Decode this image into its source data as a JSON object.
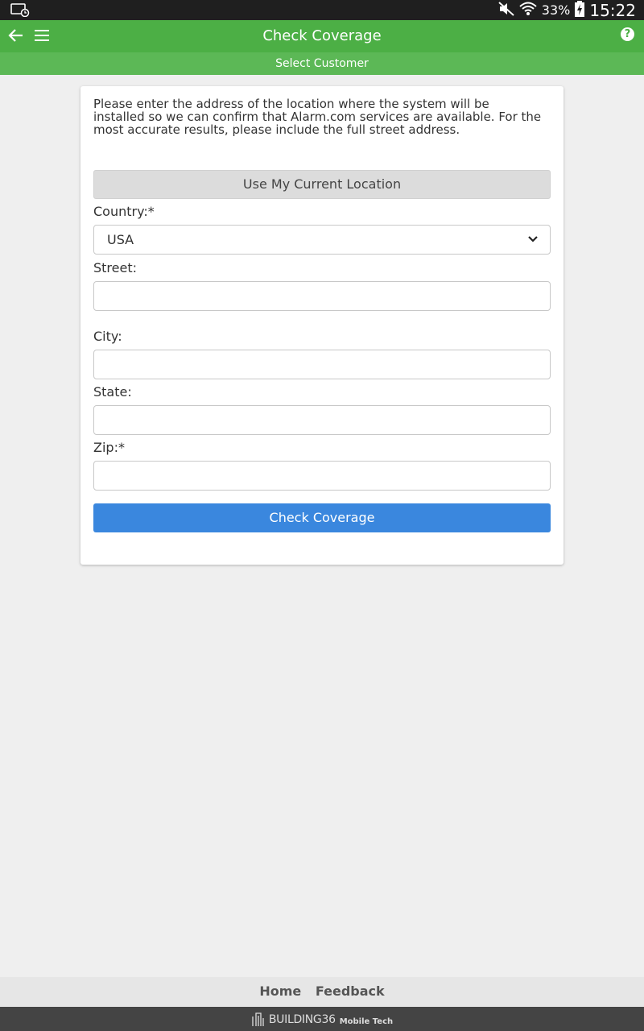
{
  "status_bar": {
    "battery_percent": "33%",
    "time": "15:22"
  },
  "app_bar": {
    "title": "Check Coverage",
    "help_glyph": "?"
  },
  "sub_bar": {
    "label": "Select Customer"
  },
  "form": {
    "intro_text": "Please enter the address of the location where the system will be installed so we can confirm that Alarm.com services are available. For the most accurate results, please include the full street address.",
    "location_button": "Use My Current Location",
    "country_label": "Country:*",
    "country_value": "USA",
    "street_label": "Street:",
    "street_value": "",
    "city_label": "City:",
    "city_value": "",
    "state_label": "State:",
    "state_value": "",
    "zip_label": "Zip:*",
    "zip_value": "",
    "submit_button": "Check Coverage"
  },
  "footer": {
    "home_link": "Home",
    "feedback_link": "Feedback",
    "brand_main": "BUILDING36",
    "brand_sub": "Mobile Tech"
  },
  "colors": {
    "app_bar": "#4caf45",
    "sub_bar": "#5cb856",
    "primary_button": "#3a87de"
  },
  "icons": {
    "back": "arrow-left-icon",
    "menu": "hamburger-menu-icon",
    "help": "help-icon",
    "dropdown": "chevron-down-icon"
  }
}
